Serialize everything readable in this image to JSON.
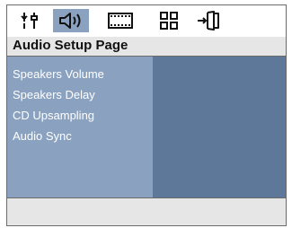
{
  "tabs": [
    {
      "icon": "general-setup-icon",
      "active": false
    },
    {
      "icon": "audio-setup-icon",
      "active": true
    },
    {
      "icon": "video-setup-icon",
      "active": false
    },
    {
      "icon": "preference-setup-icon",
      "active": false
    },
    {
      "icon": "exit-setup-icon",
      "active": false
    }
  ],
  "page_title": "Audio Setup Page",
  "menu": {
    "items": [
      "Speakers Volume",
      "Speakers Delay",
      "CD Upsampling",
      "Audio Sync"
    ]
  },
  "colors": {
    "active_tab": "#8aa2c0",
    "menu_bg": "#8aa2c0",
    "detail_bg": "#5d7898",
    "title_bg": "#e6e6e6"
  }
}
